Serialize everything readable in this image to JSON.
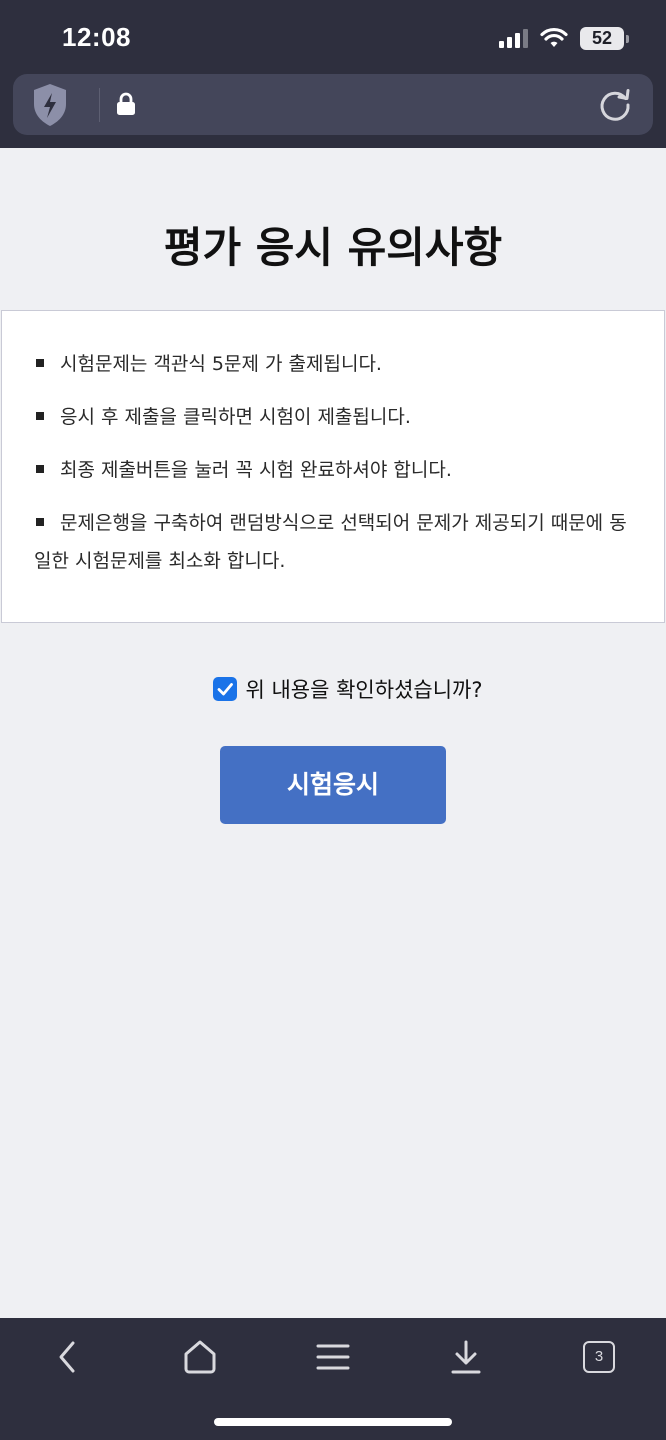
{
  "status_bar": {
    "time": "12:08",
    "battery": "52"
  },
  "browser": {
    "url_text": ""
  },
  "page": {
    "title": "평가 응시 유의사항",
    "notices": [
      "시험문제는 객관식 5문제 가 출제됩니다.",
      "응시 후 제출을 클릭하면 시험이 제출됩니다.",
      "최종 제출버튼을 눌러 꼭 시험 완료하셔야 합니다.",
      "문제은행을 구축하여 랜덤방식으로 선택되어 문제가 제공되기 때문에 동일한 시험문제를 최소화 합니다."
    ],
    "confirm_label": "위 내용을 확인하셨습니까?",
    "confirm_checked": true,
    "start_button": "시험응시"
  },
  "toolbar": {
    "tab_count": "3"
  },
  "colors": {
    "chrome": "#2e2f3e",
    "url_bar": "#44465a",
    "page_bg": "#eff0f3",
    "button": "#4470c4",
    "checkbox": "#1a73e8"
  },
  "icons": [
    "shield-icon",
    "lock-icon",
    "reload-icon",
    "back-icon",
    "home-icon",
    "menu-icon",
    "download-icon",
    "tabs-icon",
    "signal-icon",
    "wifi-icon",
    "battery-icon"
  ]
}
